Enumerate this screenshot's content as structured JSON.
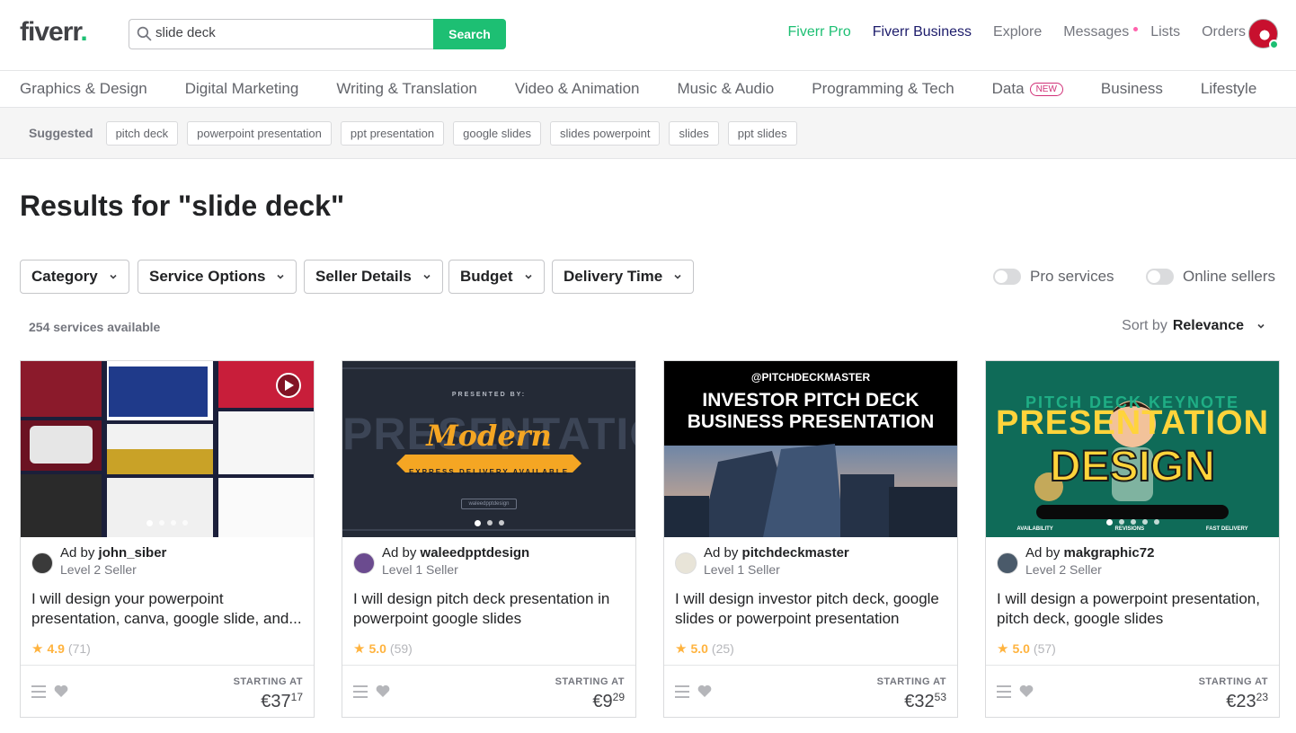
{
  "header": {
    "logo": "fiverr",
    "logo_dot": ".",
    "search_value": "slide deck",
    "search_button": "Search",
    "nav": [
      "Fiverr Pro",
      "Fiverr Business",
      "Explore",
      "Messages",
      "Lists",
      "Orders"
    ]
  },
  "categories": [
    "Graphics & Design",
    "Digital Marketing",
    "Writing & Translation",
    "Video & Animation",
    "Music & Audio",
    "Programming & Tech",
    "Data",
    "Business",
    "Lifestyle"
  ],
  "new_badge": "NEW",
  "suggested": {
    "label": "Suggested",
    "chips": [
      "pitch deck",
      "powerpoint presentation",
      "ppt presentation",
      "google slides",
      "slides powerpoint",
      "slides",
      "ppt slides"
    ]
  },
  "results_title": "Results for \"slide deck\"",
  "filters": [
    "Category",
    "Service Options",
    "Seller Details",
    "Budget",
    "Delivery Time"
  ],
  "toggles": [
    "Pro services",
    "Online sellers"
  ],
  "count": "254 services available",
  "sort": {
    "label": "Sort by",
    "value": "Relevance"
  },
  "ad_prefix": "Ad by",
  "starting_at": "STARTING AT",
  "cards": [
    {
      "seller": "john_siber",
      "level": "Level 2 Seller",
      "title": "I will design your powerpoint presentation, canva, google slide, and...",
      "score": "4.9",
      "reviews": "(71)",
      "price_main": "€37",
      "price_cents": "17"
    },
    {
      "seller": "waleedpptdesign",
      "level": "Level 1 Seller",
      "title": "I will design pitch deck presentation in powerpoint google slides",
      "score": "5.0",
      "reviews": "(59)",
      "price_main": "€9",
      "price_cents": "29",
      "thumb_top": "PRESENTED BY:",
      "thumb_big": "PRESENTATION",
      "thumb_script": "Modern",
      "thumb_banner": "EXPRESS DELIVERY AVAILABLE",
      "thumb_small": "waleedpptdesign"
    },
    {
      "seller": "pitchdeckmaster",
      "level": "Level 1 Seller",
      "title": "I will design investor pitch deck, google slides or powerpoint presentation",
      "score": "5.0",
      "reviews": "(25)",
      "price_main": "€32",
      "price_cents": "53",
      "thumb_handle": "@PITCHDECKMASTER",
      "thumb_line1": "INVESTOR PITCH DECK",
      "thumb_line2": "BUSINESS PRESENTATION"
    },
    {
      "seller": "makgraphic72",
      "level": "Level 2 Seller",
      "title": "I will design a powerpoint presentation, pitch deck, google slides",
      "score": "5.0",
      "reviews": "(57)",
      "price_main": "€23",
      "price_cents": "23",
      "thumb_top": "PITCH DECK KEYNOTE",
      "thumb_mid": "PRESENTATION",
      "thumb_big": "DESIGN",
      "thumb_labels": [
        "AVAILABILITY",
        "REVISIONS",
        "FAST DELIVERY"
      ]
    }
  ],
  "colors": {
    "brand": "#1dbf73",
    "business": "#1d1c6b",
    "star": "#ffb33e"
  }
}
